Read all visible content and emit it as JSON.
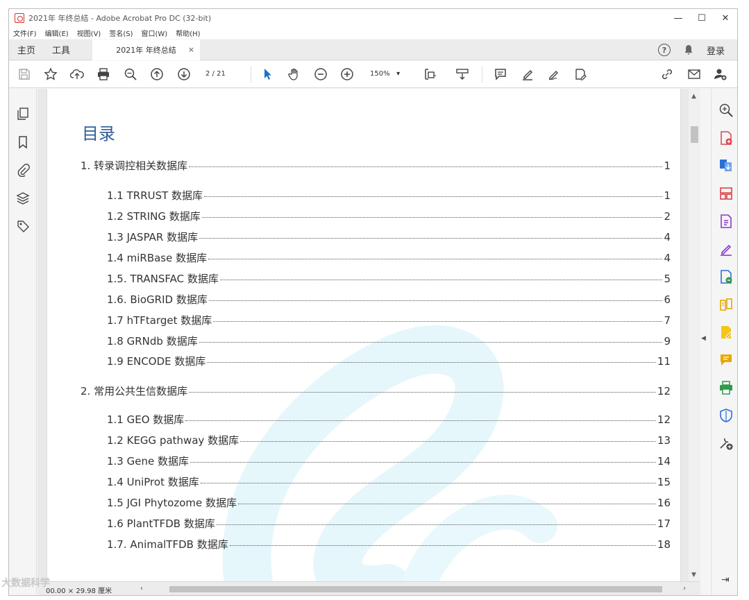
{
  "window": {
    "title": "2021年 年终总结 - Adobe Acrobat Pro DC (32-bit)",
    "controls": {
      "minimize": "—",
      "maximize": "☐",
      "close": "✕"
    }
  },
  "menu": [
    "文件(F)",
    "编辑(E)",
    "视图(V)",
    "签名(S)",
    "窗口(W)",
    "帮助(H)"
  ],
  "tabs": {
    "home": "主页",
    "tools": "工具",
    "document": "2021年 年终总结",
    "close": "×",
    "help": "?",
    "sign_in": "登录"
  },
  "toolbar": {
    "page": "2  / 21",
    "zoom": "150%",
    "icons": [
      "save-icon",
      "bookmark-star-icon",
      "upload-icon",
      "print-icon",
      "zoom-search-icon",
      "page-up-icon",
      "page-down-icon",
      "select-cursor-icon",
      "hand-icon",
      "zoom-out-icon",
      "zoom-in-icon",
      "page-fit-icon",
      "scroll-mode-icon",
      "comment-icon",
      "highlight-icon",
      "sign-icon",
      "fill-sign-icon",
      "share-link-icon",
      "email-icon",
      "add-user-icon"
    ]
  },
  "document": {
    "toc_title": "目录",
    "entries": [
      {
        "label": "1.  转录调控相关数据库",
        "page": "1"
      },
      {
        "label": "1.1 TRRUST 数据库",
        "page": "1"
      },
      {
        "label": "1.2 STRING 数据库",
        "page": "2"
      },
      {
        "label": "1.3 JASPAR 数据库",
        "page": "4"
      },
      {
        "label": "1.4 miRBase 数据库",
        "page": "4"
      },
      {
        "label": "1.5. TRANSFAC 数据库",
        "page": "5"
      },
      {
        "label": "1.6. BioGRID 数据库",
        "page": "6"
      },
      {
        "label": "1.7 hTFtarget 数据库",
        "page": "7"
      },
      {
        "label": "1.8 GRNdb 数据库",
        "page": "9"
      },
      {
        "label": "1.9 ENCODE 数据库",
        "page": "11"
      },
      {
        "label": "2.  常用公共生信数据库",
        "page": "12"
      },
      {
        "label": "1.1 GEO 数据库",
        "page": "12"
      },
      {
        "label": "1.2 KEGG pathway 数据库",
        "page": "13"
      },
      {
        "label": "1.3 Gene 数据库",
        "page": "14"
      },
      {
        "label": "1.4 UniProt 数据库",
        "page": "15"
      },
      {
        "label": "1.5 JGI Phytozome  数据库",
        "page": "16"
      },
      {
        "label": "1.6 PlantTFDB 数据库",
        "page": "17"
      },
      {
        "label": "1.7. AnimalTFDB  数据库",
        "page": "18"
      }
    ]
  },
  "statusbar": {
    "page_size": "00.00 × 29.98 厘米"
  },
  "brand": "大数据科学",
  "colors": {
    "accent_blue": "#2e5d9a",
    "tool_red": "#e0404a",
    "tool_blue": "#2b6fd6",
    "tool_purple": "#8a3bc9",
    "tool_yellow": "#e8a800",
    "tool_green": "#2e9a4a"
  }
}
